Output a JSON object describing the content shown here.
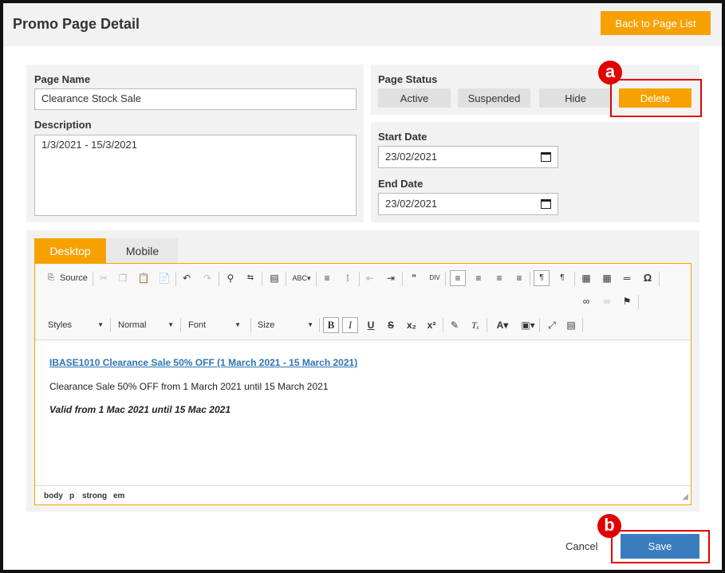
{
  "header": {
    "title": "Promo Page Detail",
    "back_label": "Back to Page List"
  },
  "form": {
    "page_name_label": "Page Name",
    "page_name_value": "Clearance Stock Sale",
    "description_label": "Description",
    "description_value": "1/3/2021 - 15/3/2021",
    "page_status_label": "Page Status",
    "status_buttons": {
      "active": "Active",
      "suspended": "Suspended",
      "hide": "Hide",
      "delete": "Delete"
    },
    "start_date_label": "Start Date",
    "start_date_value": "23/02/2021",
    "end_date_label": "End Date",
    "end_date_value": "23/02/2021"
  },
  "tabs": {
    "desktop": "Desktop",
    "mobile": "Mobile"
  },
  "editor": {
    "source_label": "Source",
    "styles_label": "Styles",
    "format_label": "Normal",
    "font_label": "Font",
    "size_label": "Size",
    "content_link": "IBASE1010 Clearance Sale 50% OFF (1 March 2021 - 15 March 2021)",
    "content_paragraph": "Clearance Sale 50% OFF from 1 March 2021 until 15 March 2021",
    "content_emphasis": "Valid from 1 Mac 2021 until 15 Mac 2021",
    "path": [
      "body",
      "p",
      "strong",
      "em"
    ]
  },
  "footer": {
    "cancel_label": "Cancel",
    "save_label": "Save"
  },
  "markers": {
    "a": "a",
    "b": "b"
  },
  "colors": {
    "accent": "#f7a100",
    "primary": "#3a7dbf",
    "highlight": "#e00000"
  }
}
